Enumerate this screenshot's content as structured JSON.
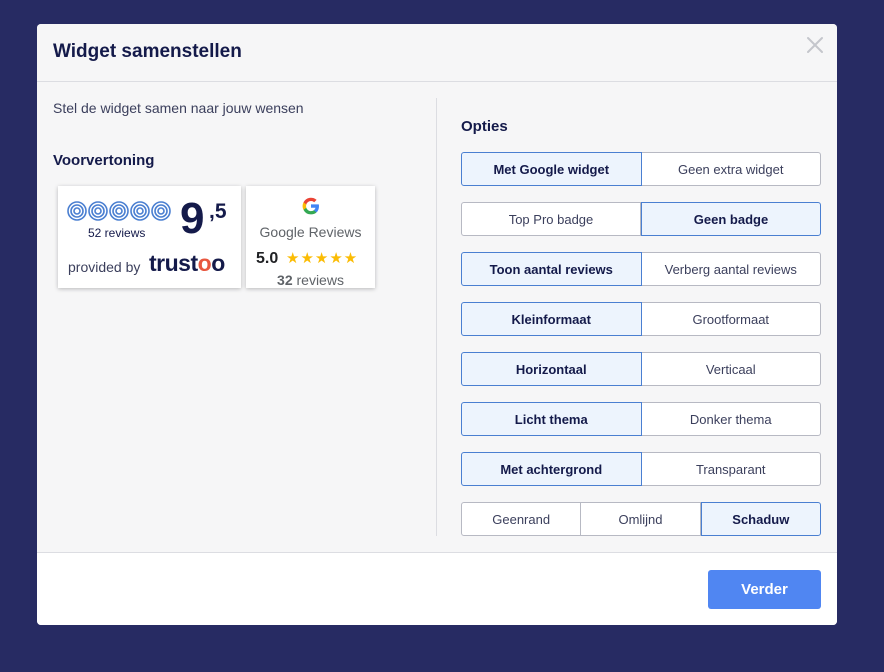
{
  "modal": {
    "title": "Widget samenstellen"
  },
  "left": {
    "intro": "Stel de widget samen naar jouw wensen",
    "preview_title": "Voorvertoning"
  },
  "trustoo_widget": {
    "reviews": "52 reviews",
    "score_main": "9",
    "score_decimal": ",5",
    "provided_by": "provided by",
    "brand_before": "trust",
    "brand_o": "o",
    "brand_after": "o"
  },
  "google_widget": {
    "name": "Google Reviews",
    "rating": "5.0",
    "stars": "★★★★★",
    "review_count": "32",
    "review_word": " reviews"
  },
  "options": {
    "title": "Opties",
    "rows": [
      {
        "segments": [
          "Met Google widget",
          "Geen extra widget"
        ],
        "active": 0
      },
      {
        "segments": [
          "Top Pro badge",
          "Geen badge"
        ],
        "active": 1
      },
      {
        "segments": [
          "Toon aantal reviews",
          "Verberg aantal reviews"
        ],
        "active": 0
      },
      {
        "segments": [
          "Kleinformaat",
          "Grootformaat"
        ],
        "active": 0
      },
      {
        "segments": [
          "Horizontaal",
          "Verticaal"
        ],
        "active": 0
      },
      {
        "segments": [
          "Licht thema",
          "Donker thema"
        ],
        "active": 0
      },
      {
        "segments": [
          "Met achtergrond",
          "Transparant"
        ],
        "active": 0
      },
      {
        "segments": [
          "Geenrand",
          "Omlijnd",
          "Schaduw"
        ],
        "active": 2
      }
    ]
  },
  "footer": {
    "next_label": "Verder"
  },
  "colors": {
    "accent": "#5086f2",
    "active_border": "#4a7fd1",
    "backdrop": "#272b63"
  }
}
